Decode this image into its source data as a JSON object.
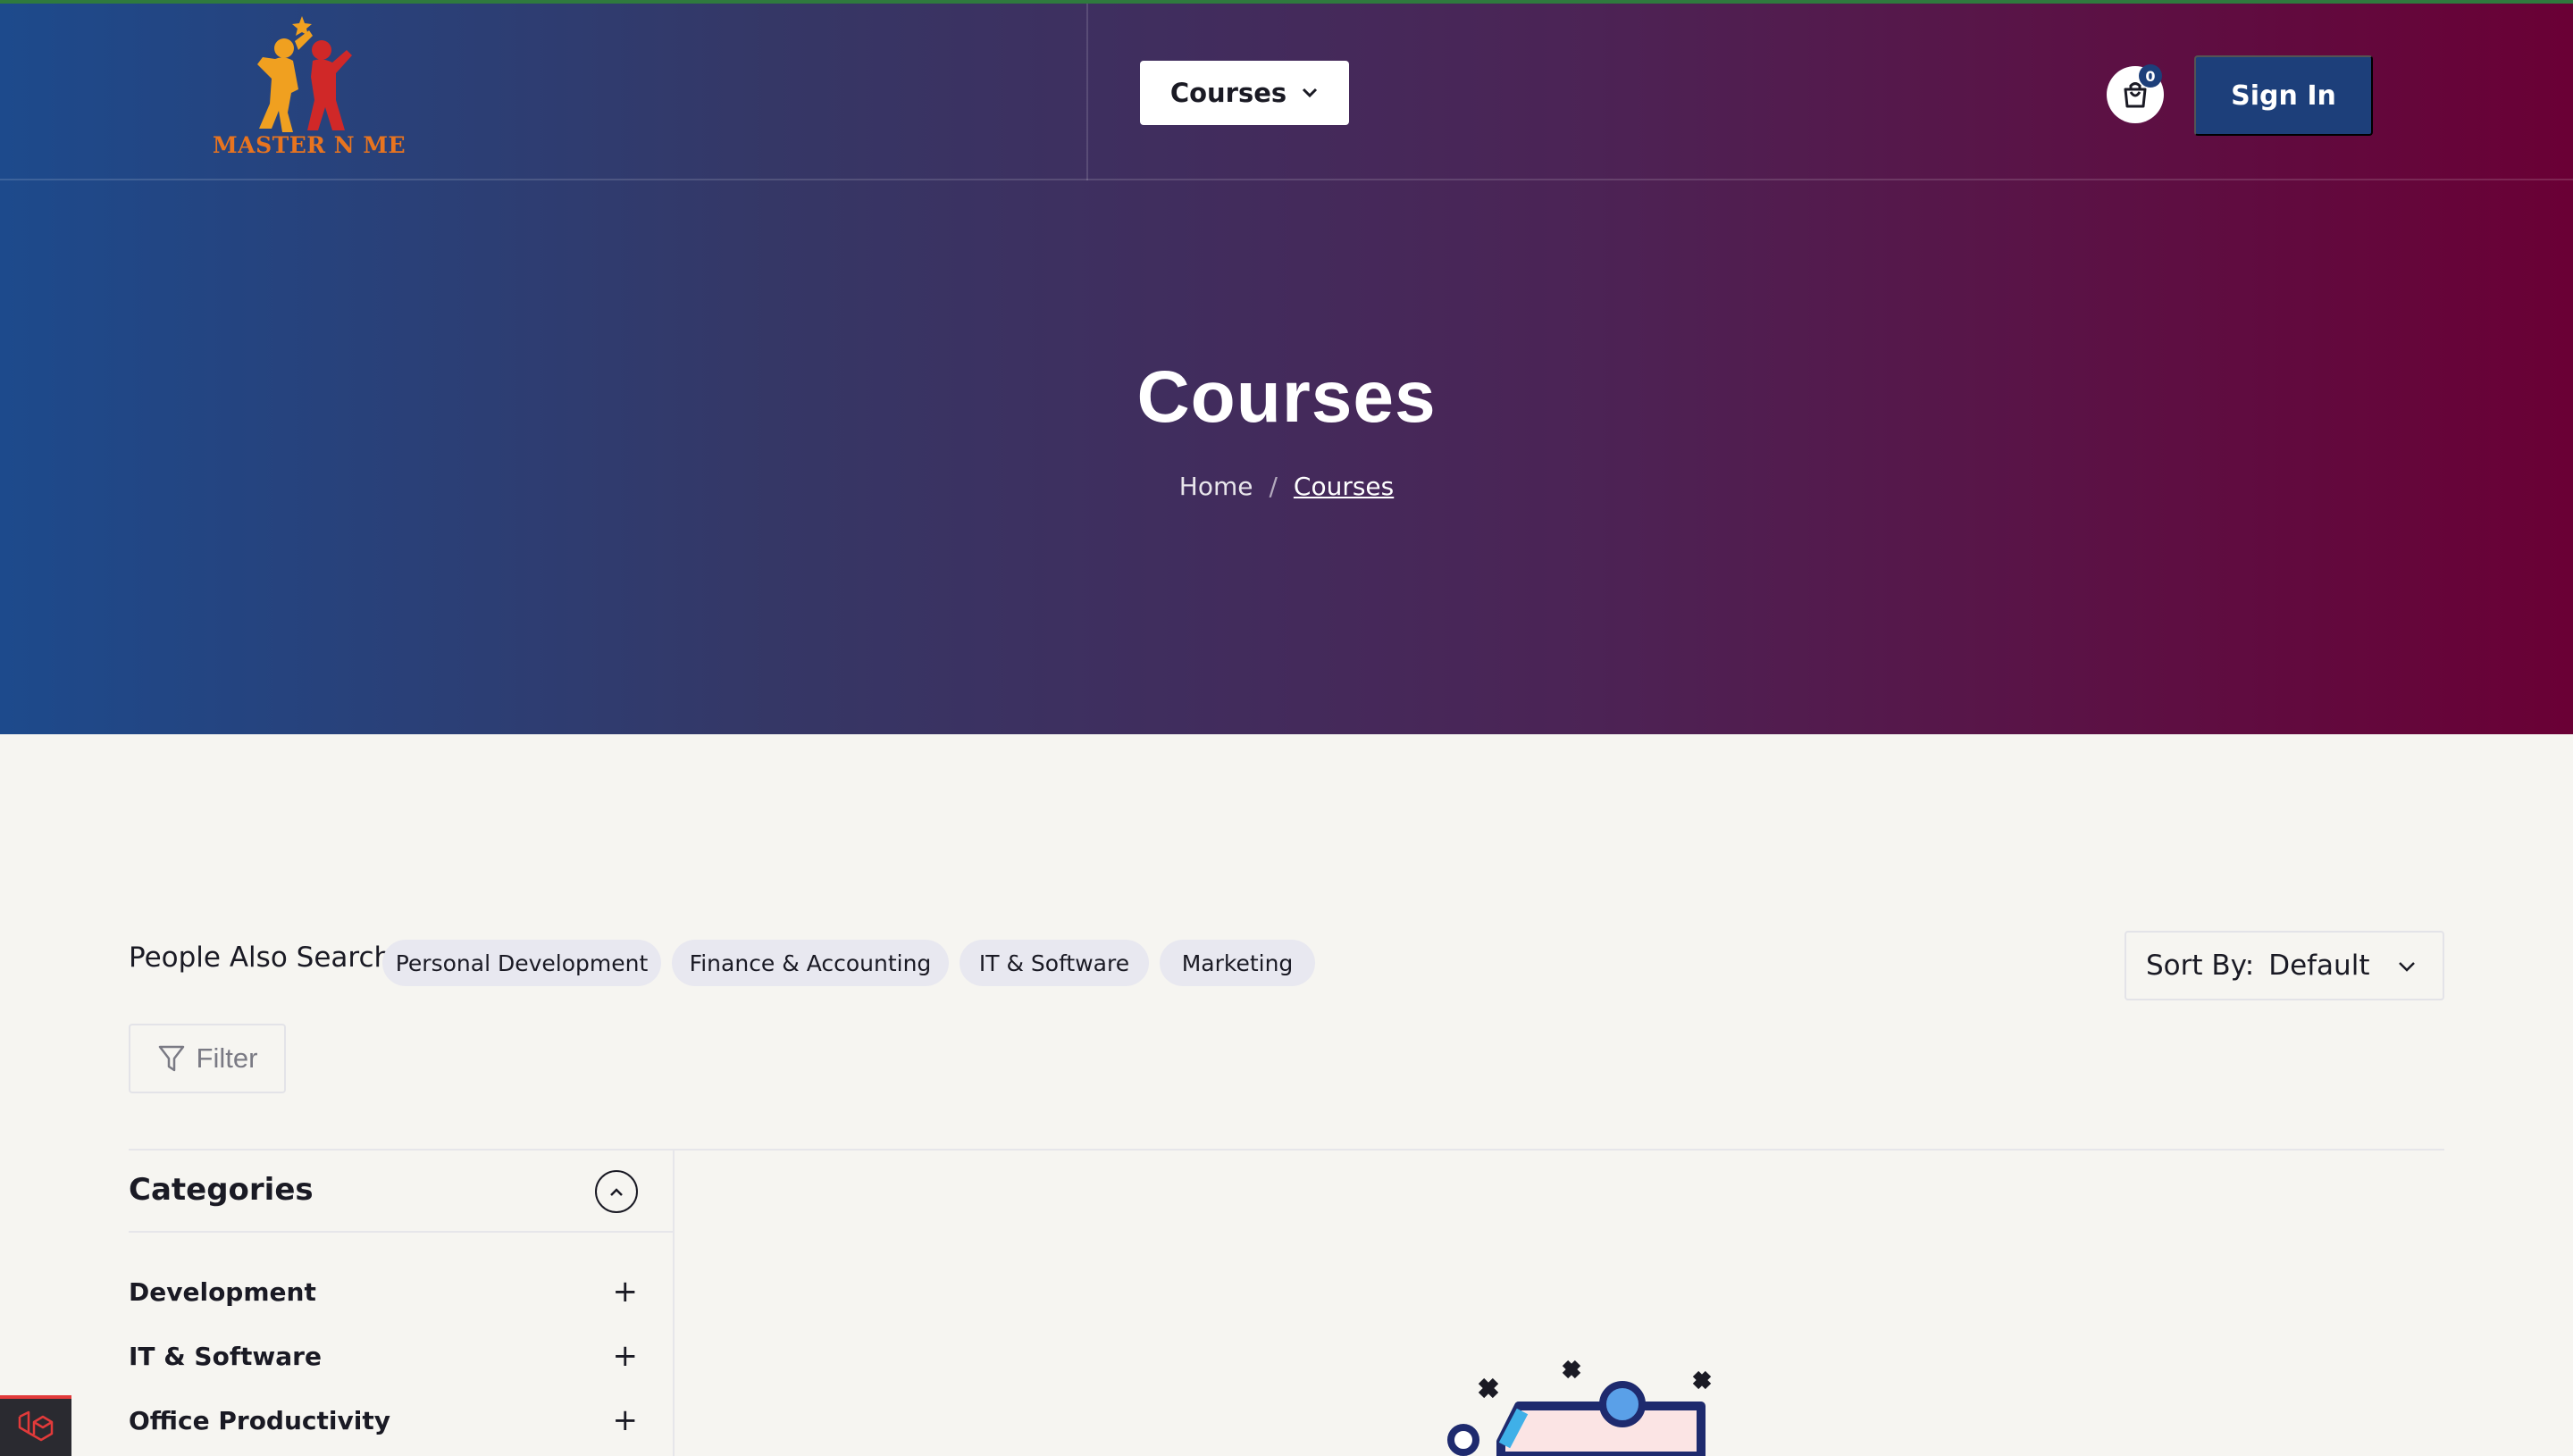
{
  "header": {
    "logo_text": "MASTER N ME",
    "courses_menu_label": "Courses",
    "cart_count": "0",
    "signin_label": "Sign In"
  },
  "hero": {
    "title": "Courses",
    "breadcrumb": {
      "home": "Home",
      "separator": "/",
      "current": "Courses"
    }
  },
  "search": {
    "label": "People Also Search:",
    "chips": [
      "Personal Development",
      "Finance & Accounting",
      "IT & Software",
      "Marketing"
    ]
  },
  "sort": {
    "label": "Sort By:",
    "value": "Default"
  },
  "filter": {
    "label": "Filter"
  },
  "categories": {
    "title": "Categories",
    "items": [
      "Development",
      "IT & Software",
      "Office Productivity"
    ]
  },
  "colors": {
    "gradient_start": "#1d4a8c",
    "gradient_end": "#6a0035",
    "primary_button": "#1d3f7a",
    "page_background": "#f6f5f1"
  }
}
